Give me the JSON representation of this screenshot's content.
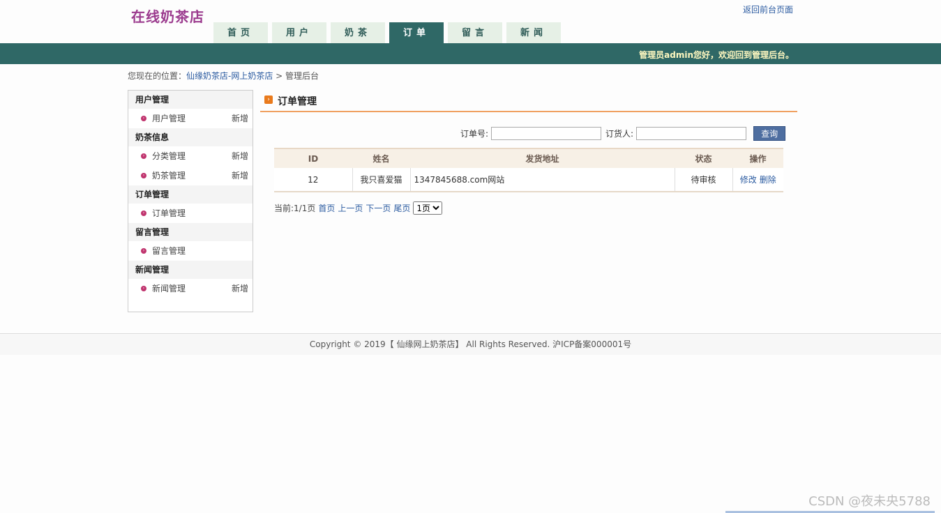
{
  "header": {
    "logo": "在线奶茶店",
    "return_link": "返回前台页面",
    "nav": [
      {
        "label": "首页",
        "active": false
      },
      {
        "label": "用户",
        "active": false
      },
      {
        "label": "奶茶",
        "active": false
      },
      {
        "label": "订单",
        "active": true
      },
      {
        "label": "留言",
        "active": false
      },
      {
        "label": "新闻",
        "active": false
      }
    ],
    "welcome": "管理员admin您好，欢迎回到管理后台。"
  },
  "breadcrumb": {
    "prefix": "您现在的位置：",
    "link": "仙缘奶茶店-网上奶茶店",
    "separator": " > ",
    "current": "管理后台"
  },
  "sidebar": {
    "groups": [
      {
        "title": "用户管理",
        "items": [
          {
            "label": "用户管理",
            "add": "新增"
          }
        ]
      },
      {
        "title": "奶茶信息",
        "items": [
          {
            "label": "分类管理",
            "add": "新增"
          },
          {
            "label": "奶茶管理",
            "add": "新增"
          }
        ]
      },
      {
        "title": "订单管理",
        "items": [
          {
            "label": "订单管理",
            "add": ""
          }
        ]
      },
      {
        "title": "留言管理",
        "items": [
          {
            "label": "留言管理",
            "add": ""
          }
        ]
      },
      {
        "title": "新闻管理",
        "items": [
          {
            "label": "新闻管理",
            "add": "新增"
          }
        ]
      }
    ]
  },
  "main": {
    "title": "订单管理",
    "search": {
      "order_no_label": "订单号:",
      "order_no_value": "",
      "orderer_label": "订货人:",
      "orderer_value": "",
      "button": "查询"
    },
    "table": {
      "headers": [
        "ID",
        "姓名",
        "发货地址",
        "状态",
        "操作"
      ],
      "rows": [
        {
          "id": "12",
          "name": "我只喜爱猫",
          "address": "1347845688.com网站",
          "status": "待审核",
          "edit": "修改",
          "delete": "删除"
        }
      ]
    },
    "pager": {
      "current": "当前:1/1页",
      "first": "首页",
      "prev": "上一页",
      "next": "下一页",
      "last": "尾页",
      "select_value": "1页"
    }
  },
  "footer": {
    "text": "Copyright © 2019【 仙缘网上奶茶店】 All Rights Reserved. 沪ICP备案000001号"
  },
  "watermark": "CSDN @夜未央5788"
}
